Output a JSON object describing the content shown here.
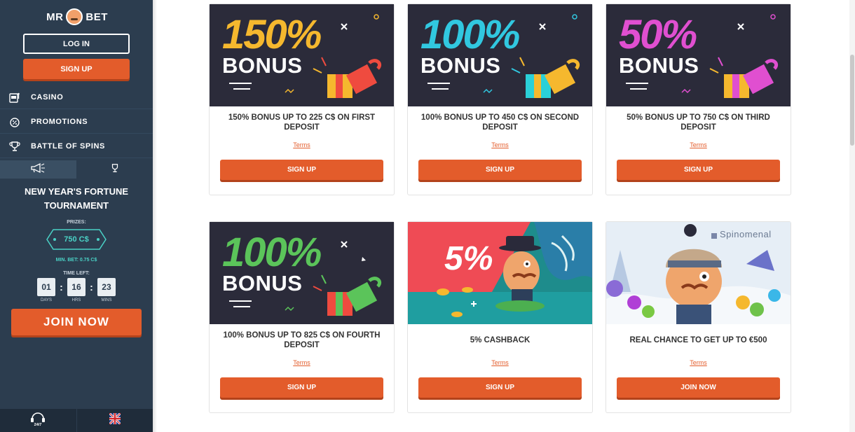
{
  "sidebar": {
    "logo": {
      "left": "MR",
      "right": "BET"
    },
    "login_label": "LOG IN",
    "signup_label": "SIGN UP",
    "nav": [
      {
        "label": "CASINO",
        "icon": "slot-machine-icon"
      },
      {
        "label": "PROMOTIONS",
        "icon": "percent-badge-icon"
      },
      {
        "label": "BATTLE OF SPINS",
        "icon": "trophy-icon"
      }
    ],
    "tabs": [
      {
        "icon": "megaphone-icon",
        "active": true
      },
      {
        "icon": "trophy-icon",
        "active": false
      }
    ],
    "tournament": {
      "title": "NEW YEAR'S FORTUNE TOURNAMENT",
      "prizes_label": "PRIZES:",
      "prize_value": "750 C$",
      "min_bet": "MIN. BET: 0.75 C$",
      "time_left_label": "TIME LEFT:",
      "timer": [
        {
          "value": "01",
          "caption": "DAYS"
        },
        {
          "value": "16",
          "caption": "HRS"
        },
        {
          "value": "23",
          "caption": "MINS"
        }
      ],
      "join_label": "JOIN NOW"
    },
    "footer": {
      "support_icon": "support-24-7-icon",
      "support_text": "24/7",
      "language_icon": "uk-flag-icon"
    }
  },
  "colors": {
    "sidebar_bg": "#2c3d4f",
    "accent": "#e35c2b",
    "teal": "#4ad2c6"
  },
  "offers": [
    {
      "banner_pct": "150%",
      "banner_word": "BONUS",
      "pct_color": "#f5b82e",
      "gift_color": "#ef4b3f",
      "title": "150% BONUS UP TO 225 C$ ON FIRST DEPOSIT",
      "terms": "Terms",
      "button": "SIGN UP"
    },
    {
      "banner_pct": "100%",
      "banner_word": "BONUS",
      "pct_color": "#31c8e0",
      "gift_color": "#2ad0d8",
      "title": "100% BONUS UP TO 450 C$ ON SECOND DEPOSIT",
      "terms": "Terms",
      "button": "SIGN UP"
    },
    {
      "banner_pct": "50%",
      "banner_word": "BONUS",
      "pct_color": "#e04fd0",
      "gift_color": "#e04fd0",
      "title": "50% BONUS UP TO 750 C$ ON THIRD DEPOSIT",
      "terms": "Terms",
      "button": "SIGN UP"
    },
    {
      "banner_pct": "100%",
      "banner_word": "BONUS",
      "pct_color": "#5bc45a",
      "gift_color": "#5bc45a",
      "title": "100% BONUS UP TO 825 C$ ON FOURTH DEPOSIT",
      "terms": "Terms",
      "button": "SIGN UP"
    },
    {
      "banner_pct": "5%",
      "title": "5% CASHBACK",
      "terms": "Terms",
      "button": "SIGN UP"
    },
    {
      "brand": "Spinomenal",
      "title": "REAL CHANCE TO GET UP TO €500",
      "terms": "Terms",
      "button": "JOIN NOW"
    }
  ]
}
